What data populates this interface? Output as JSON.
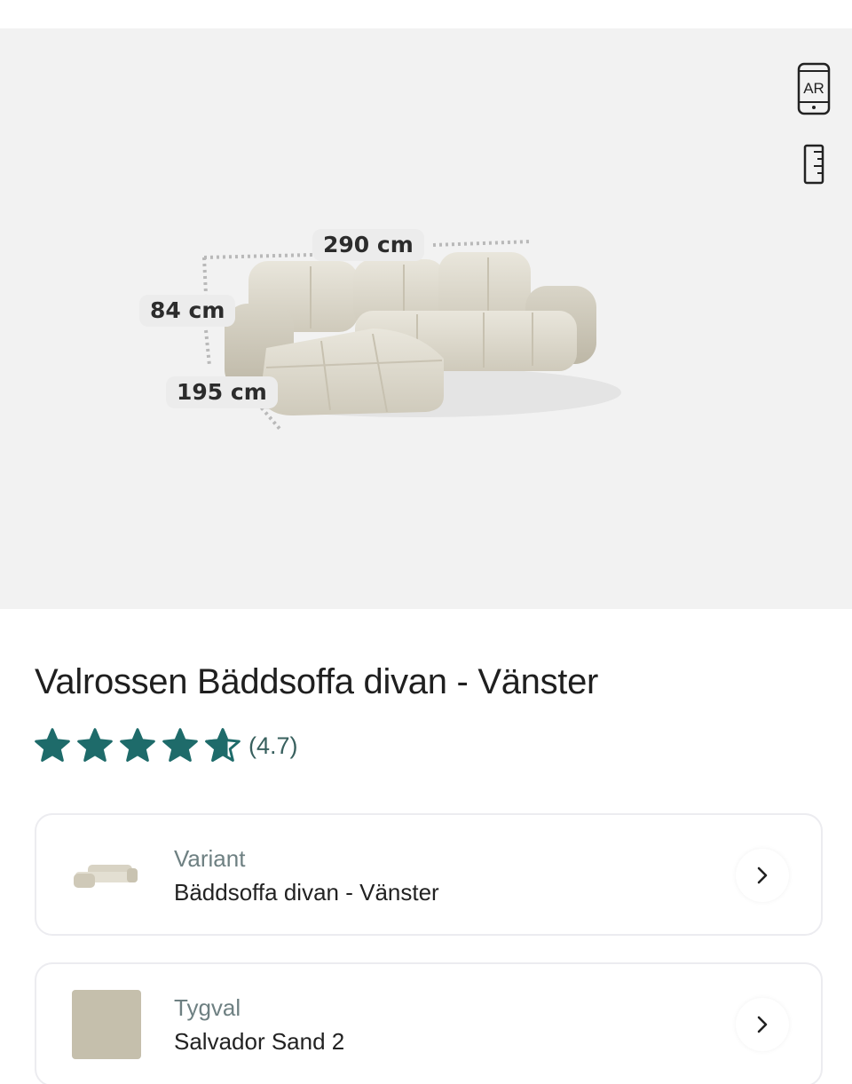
{
  "gallery": {
    "dimensions": {
      "width": "290 cm",
      "height": "84 cm",
      "depth": "195 cm"
    },
    "buttons": {
      "ar_label": "AR",
      "ar_icon": "ar-phone-icon",
      "measure_icon": "ruler-icon"
    }
  },
  "product": {
    "title": "Valrossen Bäddsoffa divan - Vänster",
    "rating_value": 4.7,
    "rating_text": "(4.7)",
    "rating_color": "#1e6b6a"
  },
  "options": [
    {
      "label": "Variant",
      "value": "Bäddsoffa divan - Vänster",
      "thumbnail_icon": "sofa-thumbnail-icon"
    },
    {
      "label": "Tygval",
      "value": "Salvador Sand 2",
      "swatch_color": "#c5bfac"
    }
  ]
}
